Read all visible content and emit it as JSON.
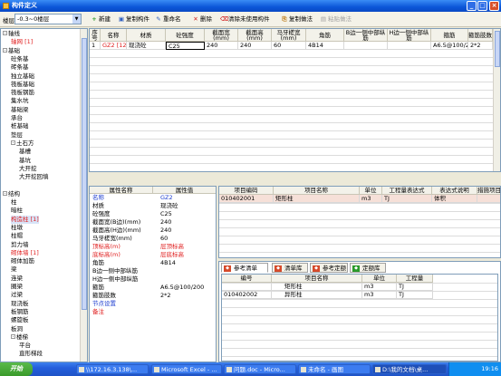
{
  "window": {
    "title": "构件定义"
  },
  "toolbar": {
    "floor_label": "楼层",
    "floor_value": "-0.3~0楼层",
    "buttons": [
      {
        "icon": "new-icon",
        "glyph": "+",
        "label": "新建"
      },
      {
        "icon": "copy-icon",
        "glyph": "▣",
        "label": "复制构件"
      },
      {
        "icon": "rename-icon",
        "glyph": "✎",
        "label": "重命名"
      },
      {
        "icon": "delete-icon",
        "glyph": "✕",
        "label": "删除"
      },
      {
        "icon": "clear-icon",
        "glyph": "⌫",
        "label": "清除未使用构件"
      },
      {
        "icon": "copy-method-icon",
        "glyph": "⎘",
        "label": "复制做法"
      },
      {
        "icon": "paste-method-icon",
        "glyph": "▤",
        "label": "粘贴做法"
      }
    ]
  },
  "tree": {
    "items": [
      {
        "label": "轴线",
        "level": 0,
        "box": "-",
        "red": false
      },
      {
        "label": "轴网 [1]",
        "level": 1,
        "box": "",
        "red": true
      },
      {
        "label": "基础",
        "level": 0,
        "box": "-",
        "red": false
      },
      {
        "label": "砼条基",
        "level": 1,
        "box": "",
        "red": false
      },
      {
        "label": "砖条基",
        "level": 1,
        "box": "",
        "red": false
      },
      {
        "label": "独立基础",
        "level": 1,
        "box": "",
        "red": false
      },
      {
        "label": "筏板基础",
        "level": 1,
        "box": "",
        "red": false
      },
      {
        "label": "筏板钢筋",
        "level": 1,
        "box": "",
        "red": false
      },
      {
        "label": "集水坑",
        "level": 1,
        "box": "",
        "red": false
      },
      {
        "label": "基础梁",
        "level": 1,
        "box": "",
        "red": false
      },
      {
        "label": "承台",
        "level": 1,
        "box": "",
        "red": false
      },
      {
        "label": "桩基础",
        "level": 1,
        "box": "",
        "red": false
      },
      {
        "label": "垫层",
        "level": 1,
        "box": "",
        "red": false
      },
      {
        "label": "土石方",
        "level": 1,
        "box": "-",
        "red": false
      },
      {
        "label": "基槽",
        "level": 2,
        "box": "",
        "red": false
      },
      {
        "label": "基坑",
        "level": 2,
        "box": "",
        "red": false
      },
      {
        "label": "大开挖",
        "level": 2,
        "box": "",
        "red": false
      },
      {
        "label": "大开挖回填",
        "level": 2,
        "box": "",
        "red": false
      },
      {
        "label": "",
        "level": 0,
        "box": "",
        "red": false
      },
      {
        "label": "结构",
        "level": 0,
        "box": "-",
        "red": false
      },
      {
        "label": "柱",
        "level": 1,
        "box": "",
        "red": false
      },
      {
        "label": "暗柱",
        "level": 1,
        "box": "",
        "red": false
      },
      {
        "label": "构造柱 [1]",
        "level": 1,
        "box": "",
        "red": true,
        "selected": true
      },
      {
        "label": "柱墩",
        "level": 1,
        "box": "",
        "red": false
      },
      {
        "label": "柱帽",
        "level": 1,
        "box": "",
        "red": false
      },
      {
        "label": "剪力墙",
        "level": 1,
        "box": "",
        "red": false
      },
      {
        "label": "砌体墙 [1]",
        "level": 1,
        "box": "",
        "red": true
      },
      {
        "label": "砌体加筋",
        "level": 1,
        "box": "",
        "red": false
      },
      {
        "label": "梁",
        "level": 1,
        "box": "",
        "red": false
      },
      {
        "label": "连梁",
        "level": 1,
        "box": "",
        "red": false
      },
      {
        "label": "圈梁",
        "level": 1,
        "box": "",
        "red": false
      },
      {
        "label": "过梁",
        "level": 1,
        "box": "",
        "red": false
      },
      {
        "label": "现浇板",
        "level": 1,
        "box": "",
        "red": false
      },
      {
        "label": "板钢筋",
        "level": 1,
        "box": "",
        "red": false
      },
      {
        "label": "螺旋板",
        "level": 1,
        "box": "",
        "red": false
      },
      {
        "label": "板洞",
        "level": 1,
        "box": "",
        "red": false
      },
      {
        "label": "楼梯",
        "level": 1,
        "box": "-",
        "red": false
      },
      {
        "label": "平台",
        "level": 2,
        "box": "",
        "red": false
      },
      {
        "label": "直形梯段",
        "level": 2,
        "box": "",
        "red": false
      }
    ]
  },
  "component_grid": {
    "headers": [
      "序号",
      "名称",
      "材质",
      "砼强度",
      "截面宽(mm)",
      "截面高(mm)",
      "马牙槎宽(mm)",
      "角筋",
      "B边一侧中部纵筋",
      "H边一侧中部纵筋",
      "箍筋",
      "箍筋肢数"
    ],
    "rows": [
      [
        "1",
        "GZ2 [12]",
        "现浇砼",
        "C25",
        "240",
        "240",
        "60",
        "4B14",
        "",
        "",
        "A6.5@100/200",
        "2*2"
      ]
    ]
  },
  "properties": {
    "header_name": "属性名称",
    "header_value": "属性值",
    "rows": [
      {
        "name": "名称",
        "value": "GZ2",
        "name_color": "blue",
        "value_color": "blue"
      },
      {
        "name": "材质",
        "value": "现浇砼",
        "name_color": "",
        "value_color": ""
      },
      {
        "name": "砼强度",
        "value": "C25",
        "name_color": "",
        "value_color": ""
      },
      {
        "name": "截面宽(B边)(mm)",
        "value": "240",
        "name_color": "",
        "value_color": ""
      },
      {
        "name": "截面高(H边)(mm)",
        "value": "240",
        "name_color": "",
        "value_color": ""
      },
      {
        "name": "马牙槎宽(mm)",
        "value": "60",
        "name_color": "",
        "value_color": ""
      },
      {
        "name": "顶标高(m)",
        "value": "层顶标高",
        "name_color": "red",
        "value_color": "red"
      },
      {
        "name": "底标高(m)",
        "value": "层底标高",
        "name_color": "red",
        "value_color": "red"
      },
      {
        "name": "角筋",
        "value": "4B14",
        "name_color": "",
        "value_color": ""
      },
      {
        "name": "B边一侧中部纵筋",
        "value": "",
        "name_color": "",
        "value_color": ""
      },
      {
        "name": "H边一侧中部纵筋",
        "value": "",
        "name_color": "",
        "value_color": ""
      },
      {
        "name": "箍筋",
        "value": "A6.5@100/200",
        "name_color": "",
        "value_color": ""
      },
      {
        "name": "箍筋肢数",
        "value": "2*2",
        "name_color": "",
        "value_color": ""
      },
      {
        "name": "节点设置",
        "value": "",
        "name_color": "blue",
        "value_color": ""
      },
      {
        "name": "备注",
        "value": "",
        "name_color": "red",
        "value_color": ""
      }
    ]
  },
  "item_grid": {
    "headers": [
      "项目编码",
      "项目名称",
      "单位",
      "工程量表达式",
      "表达式说明",
      "措施项目"
    ],
    "rows": [
      [
        "010402001",
        "矩形柱",
        "m3",
        "TJ",
        "体积",
        ""
      ]
    ]
  },
  "ref_tabs": [
    {
      "label": "参考清单",
      "active": true
    },
    {
      "label": "清单库",
      "active": false
    },
    {
      "label": "参考定额",
      "active": false
    },
    {
      "label": "定额库",
      "active": false
    }
  ],
  "ref_grid": {
    "headers": [
      "编号",
      "项目名称",
      "单位",
      "工程量"
    ],
    "rows": [
      [
        "",
        "矩形柱",
        "m3",
        "TJ"
      ],
      [
        "010402002",
        "异形柱",
        "m3",
        "TJ"
      ]
    ]
  },
  "taskbar": {
    "start": "开始",
    "tasks": [
      {
        "label": "\\\\172.16.3.138\\...",
        "active": false
      },
      {
        "label": "Microsoft Excel - ...",
        "active": false
      },
      {
        "label": "问题.doc - Micro...",
        "active": false
      },
      {
        "label": "未命名 - 画图",
        "active": false
      },
      {
        "label": "D:\\我的文档\\桌...",
        "active": true
      }
    ],
    "clock": "19:16"
  }
}
